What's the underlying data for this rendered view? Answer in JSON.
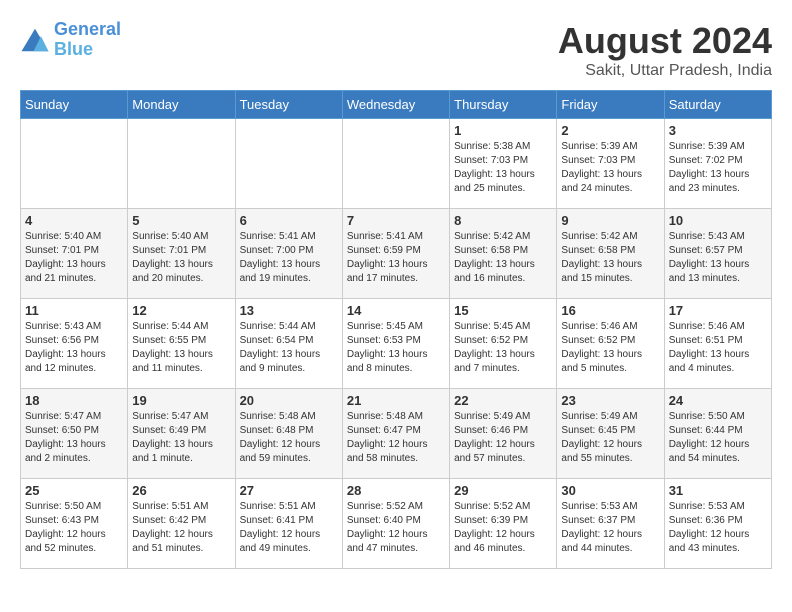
{
  "header": {
    "logo_line1": "General",
    "logo_line2": "Blue",
    "main_title": "August 2024",
    "subtitle": "Sakit, Uttar Pradesh, India"
  },
  "weekdays": [
    "Sunday",
    "Monday",
    "Tuesday",
    "Wednesday",
    "Thursday",
    "Friday",
    "Saturday"
  ],
  "weeks": [
    [
      {
        "day": "",
        "info": ""
      },
      {
        "day": "",
        "info": ""
      },
      {
        "day": "",
        "info": ""
      },
      {
        "day": "",
        "info": ""
      },
      {
        "day": "1",
        "info": "Sunrise: 5:38 AM\nSunset: 7:03 PM\nDaylight: 13 hours\nand 25 minutes."
      },
      {
        "day": "2",
        "info": "Sunrise: 5:39 AM\nSunset: 7:03 PM\nDaylight: 13 hours\nand 24 minutes."
      },
      {
        "day": "3",
        "info": "Sunrise: 5:39 AM\nSunset: 7:02 PM\nDaylight: 13 hours\nand 23 minutes."
      }
    ],
    [
      {
        "day": "4",
        "info": "Sunrise: 5:40 AM\nSunset: 7:01 PM\nDaylight: 13 hours\nand 21 minutes."
      },
      {
        "day": "5",
        "info": "Sunrise: 5:40 AM\nSunset: 7:01 PM\nDaylight: 13 hours\nand 20 minutes."
      },
      {
        "day": "6",
        "info": "Sunrise: 5:41 AM\nSunset: 7:00 PM\nDaylight: 13 hours\nand 19 minutes."
      },
      {
        "day": "7",
        "info": "Sunrise: 5:41 AM\nSunset: 6:59 PM\nDaylight: 13 hours\nand 17 minutes."
      },
      {
        "day": "8",
        "info": "Sunrise: 5:42 AM\nSunset: 6:58 PM\nDaylight: 13 hours\nand 16 minutes."
      },
      {
        "day": "9",
        "info": "Sunrise: 5:42 AM\nSunset: 6:58 PM\nDaylight: 13 hours\nand 15 minutes."
      },
      {
        "day": "10",
        "info": "Sunrise: 5:43 AM\nSunset: 6:57 PM\nDaylight: 13 hours\nand 13 minutes."
      }
    ],
    [
      {
        "day": "11",
        "info": "Sunrise: 5:43 AM\nSunset: 6:56 PM\nDaylight: 13 hours\nand 12 minutes."
      },
      {
        "day": "12",
        "info": "Sunrise: 5:44 AM\nSunset: 6:55 PM\nDaylight: 13 hours\nand 11 minutes."
      },
      {
        "day": "13",
        "info": "Sunrise: 5:44 AM\nSunset: 6:54 PM\nDaylight: 13 hours\nand 9 minutes."
      },
      {
        "day": "14",
        "info": "Sunrise: 5:45 AM\nSunset: 6:53 PM\nDaylight: 13 hours\nand 8 minutes."
      },
      {
        "day": "15",
        "info": "Sunrise: 5:45 AM\nSunset: 6:52 PM\nDaylight: 13 hours\nand 7 minutes."
      },
      {
        "day": "16",
        "info": "Sunrise: 5:46 AM\nSunset: 6:52 PM\nDaylight: 13 hours\nand 5 minutes."
      },
      {
        "day": "17",
        "info": "Sunrise: 5:46 AM\nSunset: 6:51 PM\nDaylight: 13 hours\nand 4 minutes."
      }
    ],
    [
      {
        "day": "18",
        "info": "Sunrise: 5:47 AM\nSunset: 6:50 PM\nDaylight: 13 hours\nand 2 minutes."
      },
      {
        "day": "19",
        "info": "Sunrise: 5:47 AM\nSunset: 6:49 PM\nDaylight: 13 hours\nand 1 minute."
      },
      {
        "day": "20",
        "info": "Sunrise: 5:48 AM\nSunset: 6:48 PM\nDaylight: 12 hours\nand 59 minutes."
      },
      {
        "day": "21",
        "info": "Sunrise: 5:48 AM\nSunset: 6:47 PM\nDaylight: 12 hours\nand 58 minutes."
      },
      {
        "day": "22",
        "info": "Sunrise: 5:49 AM\nSunset: 6:46 PM\nDaylight: 12 hours\nand 57 minutes."
      },
      {
        "day": "23",
        "info": "Sunrise: 5:49 AM\nSunset: 6:45 PM\nDaylight: 12 hours\nand 55 minutes."
      },
      {
        "day": "24",
        "info": "Sunrise: 5:50 AM\nSunset: 6:44 PM\nDaylight: 12 hours\nand 54 minutes."
      }
    ],
    [
      {
        "day": "25",
        "info": "Sunrise: 5:50 AM\nSunset: 6:43 PM\nDaylight: 12 hours\nand 52 minutes."
      },
      {
        "day": "26",
        "info": "Sunrise: 5:51 AM\nSunset: 6:42 PM\nDaylight: 12 hours\nand 51 minutes."
      },
      {
        "day": "27",
        "info": "Sunrise: 5:51 AM\nSunset: 6:41 PM\nDaylight: 12 hours\nand 49 minutes."
      },
      {
        "day": "28",
        "info": "Sunrise: 5:52 AM\nSunset: 6:40 PM\nDaylight: 12 hours\nand 47 minutes."
      },
      {
        "day": "29",
        "info": "Sunrise: 5:52 AM\nSunset: 6:39 PM\nDaylight: 12 hours\nand 46 minutes."
      },
      {
        "day": "30",
        "info": "Sunrise: 5:53 AM\nSunset: 6:37 PM\nDaylight: 12 hours\nand 44 minutes."
      },
      {
        "day": "31",
        "info": "Sunrise: 5:53 AM\nSunset: 6:36 PM\nDaylight: 12 hours\nand 43 minutes."
      }
    ]
  ]
}
